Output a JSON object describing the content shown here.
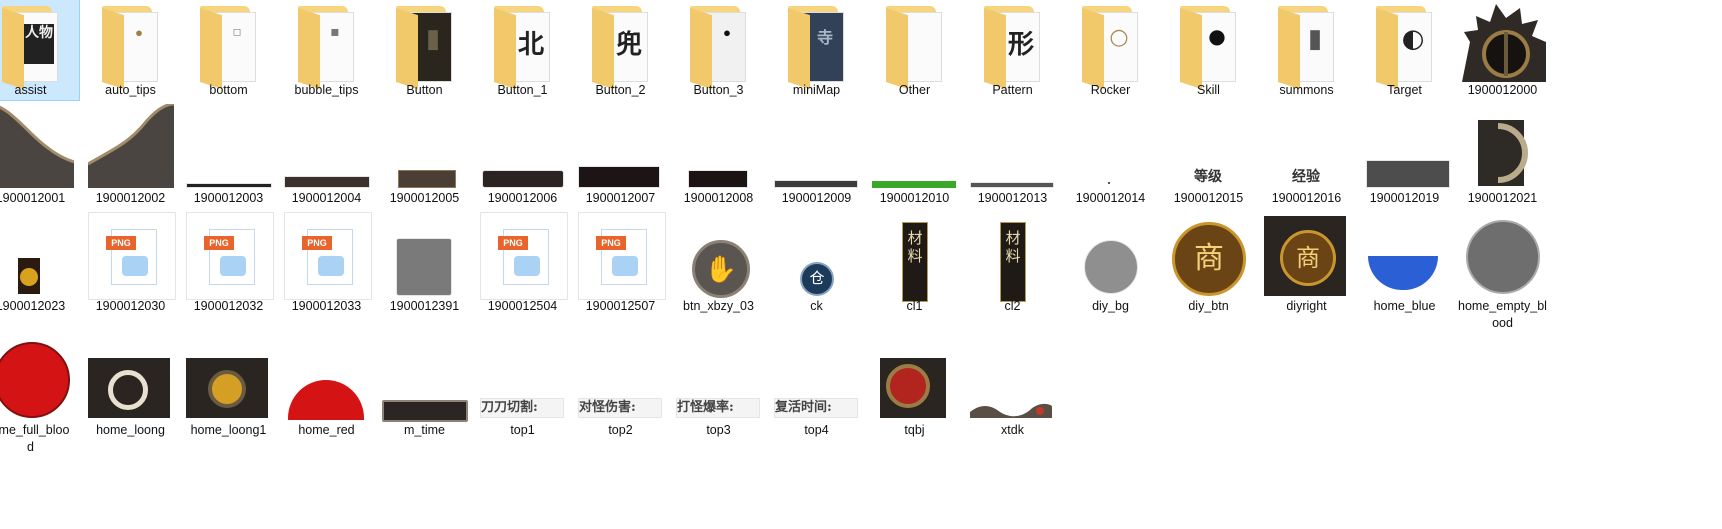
{
  "colors": {
    "selection_bg": "#cce8ff",
    "folder_yellow": "#f6d57e",
    "png_badge": "#e8642c",
    "green_bar": "#3aa62a",
    "orb_red": "#d41414",
    "orb_blue": "#2a5fd6"
  },
  "items": [
    {
      "name": "assist",
      "kind": "folder",
      "glyph": "人物"
    },
    {
      "name": "auto_tips",
      "kind": "folder",
      "glyph": "•"
    },
    {
      "name": "bottom",
      "kind": "folder",
      "glyph": "▫"
    },
    {
      "name": "bubble_tips",
      "kind": "folder",
      "glyph": "▪"
    },
    {
      "name": "Button",
      "kind": "folder",
      "glyph": "▮"
    },
    {
      "name": "Button_1",
      "kind": "folder",
      "glyph": "北"
    },
    {
      "name": "Button_2",
      "kind": "folder",
      "glyph": "兜"
    },
    {
      "name": "Button_3",
      "kind": "folder",
      "glyph": "•"
    },
    {
      "name": "miniMap",
      "kind": "folder",
      "glyph": "寺"
    },
    {
      "name": "Other",
      "kind": "folder",
      "glyph": ""
    },
    {
      "name": "Pattern",
      "kind": "folder",
      "glyph": "形"
    },
    {
      "name": "Rocker",
      "kind": "folder",
      "glyph": "○"
    },
    {
      "name": "Skill",
      "kind": "folder",
      "glyph": "●"
    },
    {
      "name": "summons",
      "kind": "folder",
      "glyph": "▮"
    },
    {
      "name": "Target",
      "kind": "folder",
      "glyph": "◐"
    },
    {
      "name": "1900012000",
      "kind": "dragon",
      "glyph": ""
    },
    {
      "name": "1900012001",
      "kind": "stone-corner",
      "glyph": ""
    },
    {
      "name": "1900012002",
      "kind": "stone-arch",
      "glyph": ""
    },
    {
      "name": "1900012003",
      "kind": "thin-bar",
      "glyph": ""
    },
    {
      "name": "1900012004",
      "kind": "bar",
      "glyph": ""
    },
    {
      "name": "1900012005",
      "kind": "bar",
      "glyph": ""
    },
    {
      "name": "1900012006",
      "kind": "bar",
      "glyph": ""
    },
    {
      "name": "1900012007",
      "kind": "bar",
      "glyph": ""
    },
    {
      "name": "1900012008",
      "kind": "bar",
      "glyph": ""
    },
    {
      "name": "1900012009",
      "kind": "thin-bar",
      "glyph": ""
    },
    {
      "name": "1900012010",
      "kind": "green-bar",
      "glyph": ""
    },
    {
      "name": "1900012013",
      "kind": "thin-bar",
      "glyph": ""
    },
    {
      "name": "1900012014",
      "kind": "empty",
      "glyph": ""
    },
    {
      "name": "1900012015",
      "kind": "text-badge",
      "glyph": "等级"
    },
    {
      "name": "1900012016",
      "kind": "text-badge",
      "glyph": "经验"
    },
    {
      "name": "1900012019",
      "kind": "gray-bar",
      "glyph": ""
    },
    {
      "name": "1900012021",
      "kind": "half-ring",
      "glyph": ""
    },
    {
      "name": "1900012023",
      "kind": "small-orb",
      "glyph": ""
    },
    {
      "name": "1900012030",
      "kind": "png",
      "glyph": "PNG"
    },
    {
      "name": "1900012032",
      "kind": "png",
      "glyph": "PNG"
    },
    {
      "name": "1900012033",
      "kind": "png",
      "glyph": "PNG"
    },
    {
      "name": "1900012391",
      "kind": "gray-square",
      "glyph": ""
    },
    {
      "name": "1900012504",
      "kind": "png",
      "glyph": "PNG"
    },
    {
      "name": "1900012507",
      "kind": "png",
      "glyph": "PNG"
    },
    {
      "name": "btn_xbzy_03",
      "kind": "round-btn",
      "glyph": "✋"
    },
    {
      "name": "ck",
      "kind": "small-round",
      "glyph": "仓"
    },
    {
      "name": "cl1",
      "kind": "tag",
      "glyph": "材料"
    },
    {
      "name": "cl2",
      "kind": "tag",
      "glyph": "材料"
    },
    {
      "name": "diy_bg",
      "kind": "gray-circle",
      "glyph": ""
    },
    {
      "name": "diy_btn",
      "kind": "gold-btn",
      "glyph": "商"
    },
    {
      "name": "diyright",
      "kind": "gold-dragon",
      "glyph": "商"
    },
    {
      "name": "home_blue",
      "kind": "blue-half",
      "glyph": ""
    },
    {
      "name": "home_empty_blood",
      "kind": "gray-orb",
      "glyph": ""
    },
    {
      "name": "home_full_blood",
      "kind": "red-orb",
      "glyph": ""
    },
    {
      "name": "home_loong",
      "kind": "loong",
      "glyph": ""
    },
    {
      "name": "home_loong1",
      "kind": "loong",
      "glyph": ""
    },
    {
      "name": "home_red",
      "kind": "red-half",
      "glyph": ""
    },
    {
      "name": "m_time",
      "kind": "bar",
      "glyph": ""
    },
    {
      "name": "top1",
      "kind": "text-strip",
      "glyph": "刀刀切割:"
    },
    {
      "name": "top2",
      "kind": "text-strip",
      "glyph": "对怪伤害:"
    },
    {
      "name": "top3",
      "kind": "text-strip",
      "glyph": "打怪爆率:"
    },
    {
      "name": "top4",
      "kind": "text-strip",
      "glyph": "复活时间:"
    },
    {
      "name": "tqbj",
      "kind": "tqbj",
      "glyph": ""
    },
    {
      "name": "xtdk",
      "kind": "xtdk",
      "glyph": ""
    }
  ],
  "labels": {
    "home_empty_blood": [
      "home_empty_bl",
      "ood"
    ],
    "home_full_blood": [
      "ome_full_bloo",
      "d"
    ]
  }
}
